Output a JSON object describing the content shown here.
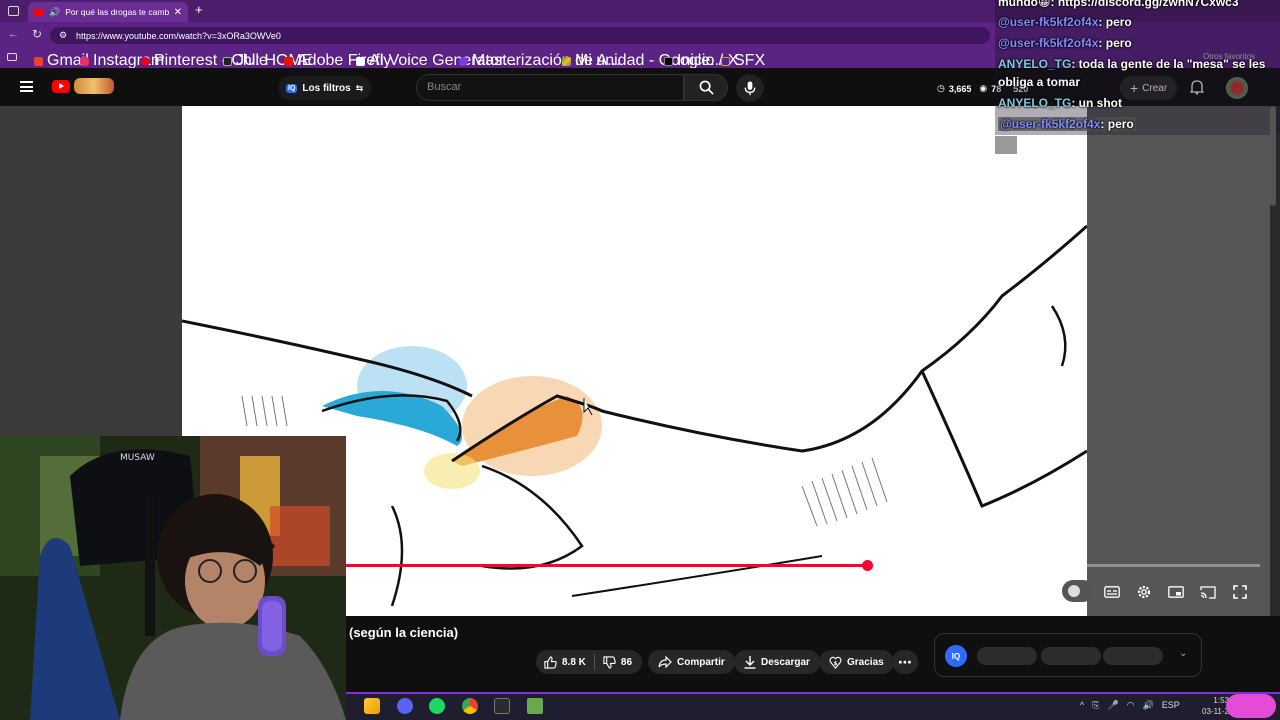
{
  "browser": {
    "tab_title": "Por qué las drogas te cambi",
    "new_tab_label": "+",
    "url": "https://www.youtube.com/watch?v=3xORa3OWVe0",
    "other_bookmarks": "Otros favoritos",
    "bookmarks": [
      {
        "label": "Gmail",
        "color": "#ea4335"
      },
      {
        "label": "Instagram",
        "color": "#e1306c"
      },
      {
        "label": "Pinterest - Chile",
        "color": "#e60023"
      },
      {
        "label": "JU: HOME",
        "color": "#222222"
      },
      {
        "label": "Adobe Firefly",
        "color": "#eb1000"
      },
      {
        "label": "AI Voice Generator...",
        "color": "#ffffff"
      },
      {
        "label": "Masterización de A...",
        "color": "#7c3aed"
      },
      {
        "label": "Mi unidad - Google...",
        "color": "#34a853"
      },
      {
        "label": "Inicio / X",
        "color": "#000000"
      },
      {
        "label": "SFX",
        "color": "#c9a227"
      }
    ]
  },
  "youtube": {
    "search_placeholder": "Buscar",
    "filters_label": "Los filtros",
    "stat_views": "3,665",
    "stat_other": "78",
    "stat_other2": "520",
    "create_label": "Crear",
    "video_title": "(según la ciencia)",
    "likes": "8.8 K",
    "dislikes": "86",
    "share_label": "Compartir",
    "download_label": "Descargar",
    "thanks_label": "Gracias",
    "progress": 0.57
  },
  "chat": [
    {
      "user": "mundo",
      "text": ": https://discord.gg/zwnN7Cxwc3",
      "style": "plain"
    },
    {
      "user": "@user-fk5kf2of4x",
      "text": ": pero",
      "style": "user"
    },
    {
      "user": "@user-fk5kf2of4x",
      "text": ": pero",
      "style": "user"
    },
    {
      "user": "ANYELO_TG",
      "text": ": toda la gente de la \"mesa\" se les",
      "style": "user2"
    },
    {
      "user": "",
      "text": "obliga a tomar",
      "style": "plain"
    },
    {
      "user": "ANYELO_TG",
      "text": ": un shot",
      "style": "user2"
    },
    {
      "user": "@user-fk5kf2of4x",
      "text": ": pero",
      "style": "user"
    }
  ],
  "taskbar": {
    "language": "ESP",
    "time": "1:53",
    "date": "03-11-2"
  },
  "colors": {
    "accent": "#ff0033",
    "browser_purple": "#5b2384",
    "taskbar_accent": "#7d2fd8"
  }
}
